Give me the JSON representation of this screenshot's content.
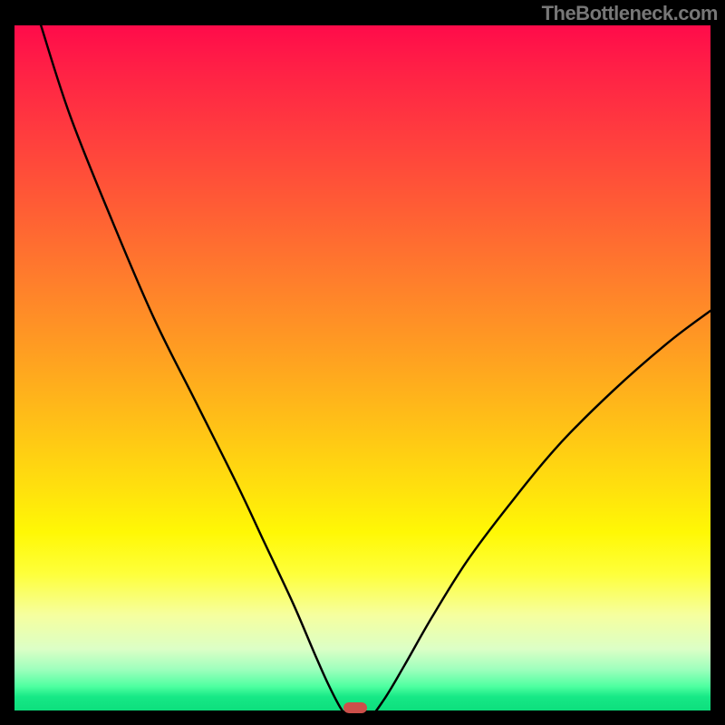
{
  "watermark": "TheBottleneck.com",
  "marker": {
    "color": "#cc4f4a"
  },
  "chart_data": {
    "type": "line",
    "title": "",
    "xlabel": "",
    "ylabel": "",
    "xlim": [
      0,
      100
    ],
    "ylim": [
      0,
      100
    ],
    "marker_x": 49,
    "series": [
      {
        "name": "left",
        "x": [
          3.8,
          8,
          14,
          20,
          26,
          32,
          36,
          40,
          43,
          45,
          46.8,
          48,
          48.2
        ],
        "y": [
          100,
          87,
          72,
          58,
          46,
          34,
          25.5,
          17,
          10,
          5.5,
          2,
          0.4,
          0
        ]
      },
      {
        "name": "flat",
        "x": [
          48.2,
          50.5
        ],
        "y": [
          0,
          0
        ]
      },
      {
        "name": "right",
        "x": [
          50.5,
          53,
          56,
          60,
          65,
          71,
          78,
          86,
          94,
          100
        ],
        "y": [
          0,
          3,
          8,
          15,
          23,
          31,
          39.5,
          47.5,
          54.5,
          59
        ]
      }
    ]
  }
}
